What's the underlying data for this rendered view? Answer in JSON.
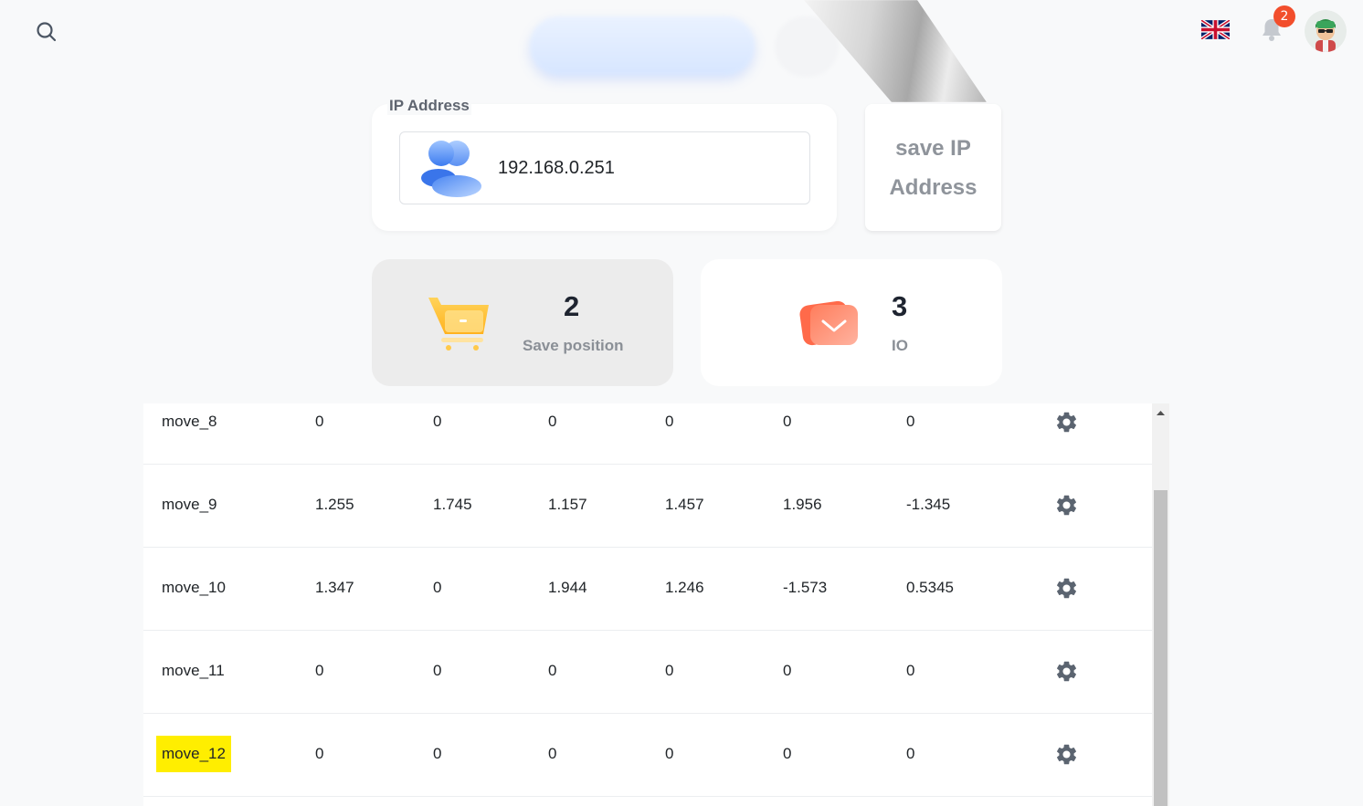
{
  "header": {
    "notification_count": "2",
    "language_flag": "uk-flag-icon"
  },
  "ip_section": {
    "label": "IP Address",
    "value": "192.168.0.251",
    "save_button": "save IP Address"
  },
  "stats": [
    {
      "value": "2",
      "label": "Save position"
    },
    {
      "value": "3",
      "label": "IO"
    }
  ],
  "table": {
    "rows": [
      {
        "name": "move_8",
        "values": [
          "0",
          "0",
          "0",
          "0",
          "0",
          "0"
        ]
      },
      {
        "name": "move_9",
        "values": [
          "1.255",
          "1.745",
          "1.157",
          "1.457",
          "1.956",
          "-1.345"
        ]
      },
      {
        "name": "move_10",
        "values": [
          "1.347",
          "0",
          "1.944",
          "1.246",
          "-1.573",
          "0.5345"
        ]
      },
      {
        "name": "move_11",
        "values": [
          "0",
          "0",
          "0",
          "0",
          "0",
          "0"
        ]
      },
      {
        "name": "move_12",
        "values": [
          "0",
          "0",
          "0",
          "0",
          "0",
          "0"
        ],
        "highlighted": true
      }
    ]
  },
  "colors": {
    "badge": "#f24e2c",
    "highlight": "#ffee00"
  }
}
